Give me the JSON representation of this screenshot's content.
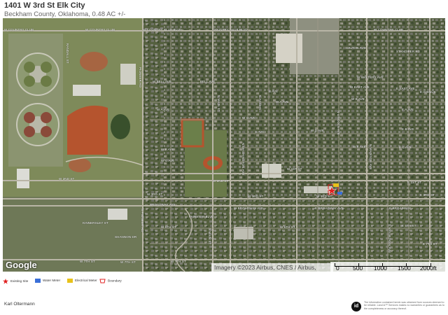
{
  "header": {
    "title": "1401 W 3rd St Elk City",
    "subtitle": "Beckham County, Oklahoma, 0.48 AC +/-"
  },
  "map": {
    "attribution": "Imagery ©2023 Airbus, CNES / Airbus,",
    "logo": "Google",
    "scale": {
      "labels": [
        "0",
        "500",
        "1000",
        "1500",
        "2000ft"
      ]
    },
    "street_labels": {
      "w_country_club_1": "W COUNTRY CLUB",
      "w_country_club_2": "W COUNTRY CLUB",
      "w_country_club_blvd": "W COUNTRY CLUB BLVD",
      "country_club_blvd": "COUNTRY CLUB BLVD",
      "w_country_club_3": "W COUNTRY CLUB",
      "dalton_ave": "DALTON AVE",
      "standifer_rd": "STANDIFER RD",
      "w_walters_ave": "W WALTERS AVE",
      "w_bell_ave": "W BELL AVE",
      "bell_ave": "BELL AVE",
      "w_east_ave": "W EAST AVE",
      "e_east_ave": "E EAST AVE",
      "e_avenue": "E AVENUE",
      "w_a_ave": "W A AVE",
      "w_a_ave_2": "W A AVE",
      "w_b_ave": "W B AVE",
      "w_c_ave": "W C AVE",
      "w_d_ave": "W D AVE",
      "w_e_ave": "W E AVE",
      "w_f_ave": "W F AVE",
      "w_g_ave": "W G AVE",
      "e_a_ave": "E A AVE",
      "e_b_ave": "E B AVE",
      "e_c_ave": "E C AVE",
      "w_3rd_st_left": "W 3RD ST",
      "w_3rd_st_mid": "W 3RD ST",
      "w_3rd_st_right": "W 3RD ST",
      "e_3rd_st": "E 3RD ST",
      "w_2nd_st": "W 2ND ST",
      "w_2nd_st_2": "W 2ND ST",
      "w_1st_st": "W 1ST ST",
      "e_1st_st": "E 1ST ST",
      "broadway_ave_1": "BROADWAY AVE",
      "w_broadway_ave": "W BROADWAY AVE",
      "e_broadway_ave": "E BROADWAY AVE",
      "e_broadway": "E BROADWAY",
      "kinnersley_st": "KINNERSLEY ST",
      "fairview_blvd": "FAIRVIEW BLVD",
      "shannon_dr": "SHANNON DR",
      "w_5th_st": "W 5TH ST",
      "w_6th_st": "W 6TH ST",
      "w_7th_st_1": "W 7TH ST",
      "w_7th_st_2": "W 7TH ST",
      "w_7th_st_3": "W 7TH ST",
      "e_5th_st": "E 5TH ST",
      "e_7th_st": "E 7TH ST",
      "b_ave": "B AVE",
      "c_ave": "C AVE"
    },
    "labels_vertical": {
      "pioneer_rd": "PIONEER RD",
      "randall_st": "RANDALL ST",
      "n_main_st": "N MAIN ST",
      "n_adams": "N ADAMS",
      "n_washington": "N WASHINGTON AVE",
      "s_main": "S MAIN ST",
      "s_pioneer": "S PIONEER RD",
      "n_lincoln": "N LINCOLN AVE",
      "n_madison": "N MADISON AVE",
      "s_van_buren": "S VAN BUREN AVE"
    }
  },
  "legend": {
    "items": [
      {
        "label": "Existing Site",
        "icon": "star-icon",
        "color": "#e02020"
      },
      {
        "label": "Water Meter",
        "icon": "water-meter-icon",
        "color": "#3a6fd8"
      },
      {
        "label": "Electrical Meter",
        "icon": "electric-meter-icon",
        "color": "#e8c21a"
      },
      {
        "label": "Boundary",
        "icon": "boundary-icon",
        "color": "#e02020"
      }
    ]
  },
  "footer": {
    "name": "Karl Oltermann",
    "logo": "id",
    "disclaimer": "The information contained herein was obtained from sources deemed to be reliable. Land id™ Services makes no warranties or guarantees as to the completeness or accuracy thereof."
  },
  "colors": {
    "map_bg": "#4e5a3f",
    "road": "#b9b5a6",
    "track": "#b5542e",
    "field": "#8a8f62",
    "pin": "#e02020"
  }
}
